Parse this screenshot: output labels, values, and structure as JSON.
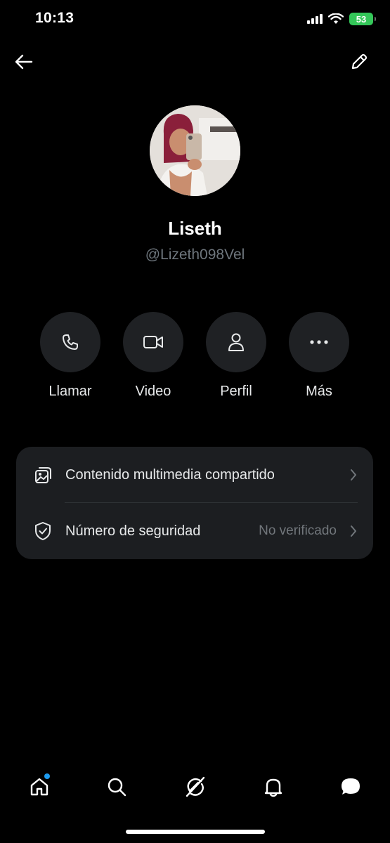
{
  "status_bar": {
    "time": "10:13",
    "battery": "53"
  },
  "profile": {
    "name": "Liseth",
    "handle": "@Lizeth098Vel"
  },
  "actions": [
    {
      "label": "Llamar",
      "icon": "phone-icon"
    },
    {
      "label": "Video",
      "icon": "video-icon"
    },
    {
      "label": "Perfil",
      "icon": "person-icon"
    },
    {
      "label": "Más",
      "icon": "more-icon"
    }
  ],
  "settings": [
    {
      "label": "Contenido multimedia compartido",
      "icon": "media-icon",
      "value": ""
    },
    {
      "label": "Número de seguridad",
      "icon": "shield-check-icon",
      "value": "No verificado"
    }
  ],
  "nav": [
    "home-icon",
    "search-icon",
    "grok-icon",
    "bell-icon",
    "messages-icon"
  ],
  "colors": {
    "accent": "#1d9bf0",
    "battery": "#34c759",
    "card": "#1c1e21",
    "muted": "#71767b"
  }
}
